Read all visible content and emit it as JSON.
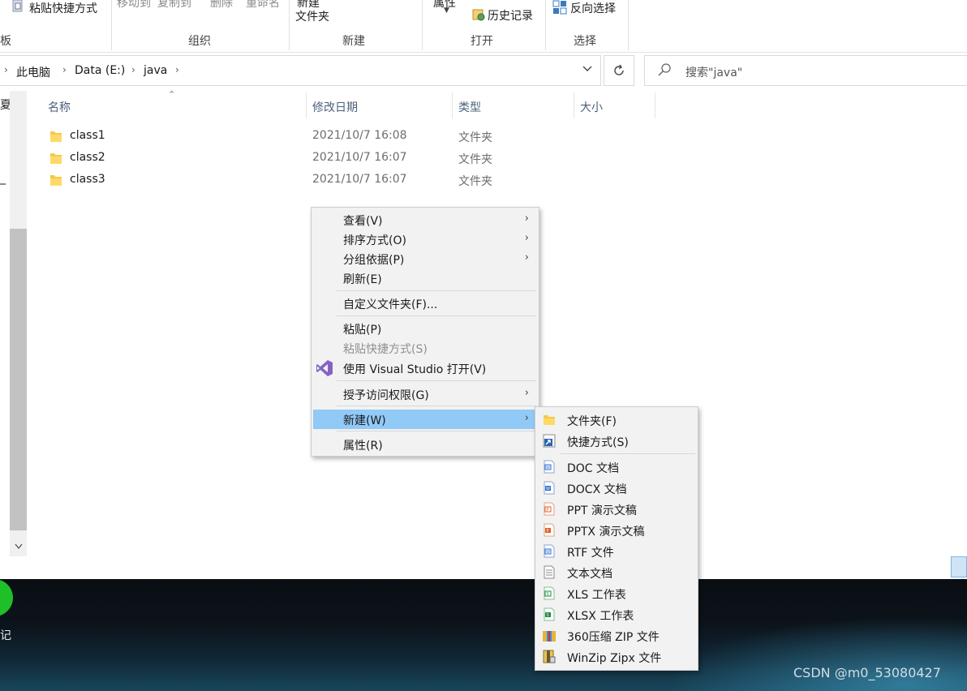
{
  "ribbon": {
    "paste_shortcut": "粘贴快捷方式",
    "move_to": "移动到",
    "copy_to": "复制到",
    "delete": "删除",
    "rename": "重命名",
    "new_folder_top": "新建",
    "new_folder_bottom": "文件夹",
    "properties": "属性",
    "history": "历史记录",
    "invert_selection": "反向选择",
    "groups": {
      "clipboard_fragment": "板",
      "organize": "组织",
      "new": "新建",
      "open": "打开",
      "select": "选择"
    }
  },
  "address": {
    "crumbs": [
      "此电脑",
      "Data (E:)",
      "java"
    ],
    "search_placeholder": "搜索\"java\""
  },
  "nav": {
    "frag1": "夏",
    "frag2": "_"
  },
  "columns": {
    "name": "名称",
    "date": "修改日期",
    "type": "类型",
    "size": "大小"
  },
  "files": [
    {
      "name": "class1",
      "date": "2021/10/7 16:08",
      "type": "文件夹"
    },
    {
      "name": "class2",
      "date": "2021/10/7 16:07",
      "type": "文件夹"
    },
    {
      "name": "class3",
      "date": "2021/10/7 16:07",
      "type": "文件夹"
    }
  ],
  "context_menu": {
    "view": "查看(V)",
    "sort_by": "排序方式(O)",
    "group_by": "分组依据(P)",
    "refresh": "刷新(E)",
    "customize": "自定义文件夹(F)...",
    "paste": "粘贴(P)",
    "paste_shortcut": "粘贴快捷方式(S)",
    "open_vs": "使用 Visual Studio 打开(V)",
    "give_access": "授予访问权限(G)",
    "new": "新建(W)",
    "properties": "属性(R)"
  },
  "submenu": {
    "folder": "文件夹(F)",
    "shortcut": "快捷方式(S)",
    "doc": "DOC 文档",
    "docx": "DOCX 文档",
    "ppt": "PPT 演示文稿",
    "pptx": "PPTX 演示文稿",
    "rtf": "RTF 文件",
    "txt": "文本文档",
    "xls": "XLS 工作表",
    "xlsx": "XLSX 工作表",
    "zip360": "360压缩 ZIP 文件",
    "winzip": "WinZip Zipx 文件"
  },
  "taskbar": {
    "app_label": "记",
    "watermark": "CSDN @m0_53080427"
  },
  "colors": {
    "highlight": "#91c9f7",
    "menu_bg": "#f2f2f2",
    "folder_yellow": "#f6c94a",
    "header_text": "#4c607a"
  }
}
